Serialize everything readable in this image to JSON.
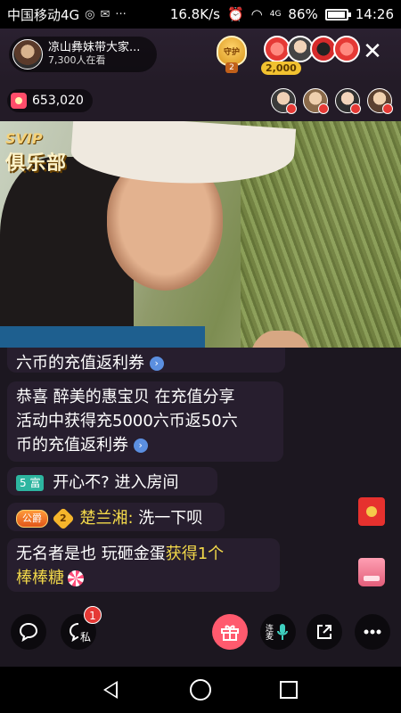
{
  "status_bar": {
    "carrier": "中国移动4G",
    "speed": "16.8K/s",
    "signal_label": "4G",
    "battery": "86%",
    "battery_level": 0.86,
    "time": "14:26"
  },
  "header": {
    "host_name": "凉山彝妹带大家...",
    "viewers": "7,300人在看",
    "guard_label": "守护",
    "guard_count": "2",
    "top_coin": "2,000"
  },
  "stats": {
    "coins": "653,020"
  },
  "video": {
    "club_badge_line1": "SVIP",
    "club_badge_line2": "俱乐部"
  },
  "chat": {
    "msg1": "六币的充值返利券",
    "msg2_line1": "恭喜 醉美的惠宝贝 在充值分享",
    "msg2_line2": "活动中获得充5000六币返50六",
    "msg2_line3": "币的充值返利券",
    "msg3_tag": "5 富",
    "msg3_text": "开心不?  进入房间",
    "msg4_tag": "公爵",
    "msg4_level": "2",
    "msg4_user": "楚兰湘:",
    "msg4_text": "洗一下呗",
    "msg5_user": "无名者是也",
    "msg5_action": "玩砸金蛋",
    "msg5_result1": "获得1个",
    "msg5_result2": "棒棒糖"
  },
  "toolbar": {
    "pm_label": "私",
    "pm_badge": "1",
    "mic_label": "连麦"
  },
  "colors": {
    "accent_pink": "#ff5a6e",
    "gold": "#f3d94a"
  }
}
